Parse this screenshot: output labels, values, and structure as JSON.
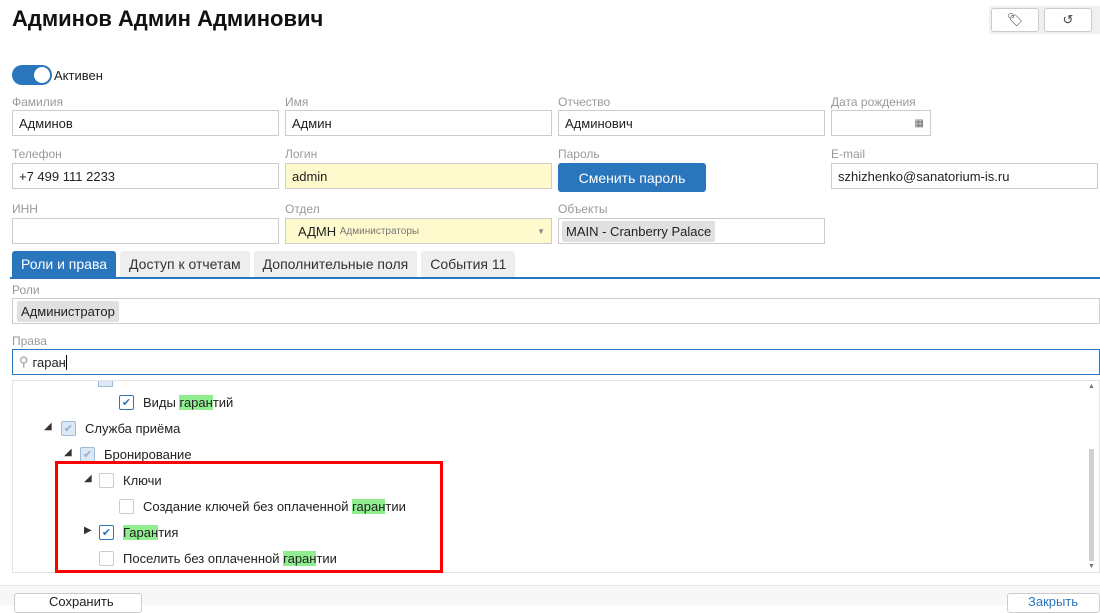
{
  "header": {
    "title": "Админов Админ Админович",
    "tag_icon": "tag-icon",
    "history_icon": "history-icon"
  },
  "status": {
    "label": "Активен",
    "active": true
  },
  "fields": {
    "lastname": {
      "label": "Фамилия",
      "value": "Админов"
    },
    "firstname": {
      "label": "Имя",
      "value": "Админ"
    },
    "middlename": {
      "label": "Отчество",
      "value": "Админович"
    },
    "birthdate": {
      "label": "Дата рождения",
      "value": ""
    },
    "phone": {
      "label": "Телефон",
      "value": "+7 499 111 2233"
    },
    "login": {
      "label": "Логин",
      "value": "admin"
    },
    "password": {
      "label": "Пароль",
      "button": "Сменить пароль"
    },
    "email": {
      "label": "E-mail",
      "value": "szhizhenko@sanatorium-is.ru"
    },
    "inn": {
      "label": "ИНН",
      "value": ""
    },
    "department": {
      "label": "Отдел",
      "code": "АДМН",
      "name": "Администраторы"
    },
    "objects": {
      "label": "Объекты",
      "value": "MAIN - Cranberry Palace"
    }
  },
  "tabs": [
    {
      "label": "Роли и права"
    },
    {
      "label": "Доступ к отчетам"
    },
    {
      "label": "Дополнительные поля"
    },
    {
      "label": "События 11"
    }
  ],
  "roles": {
    "label": "Роли",
    "value": "Администратор"
  },
  "rights": {
    "label": "Права",
    "search": "гаран"
  },
  "tree": [
    {
      "pre": "Виды ",
      "hl": "гаран",
      "post": "тий",
      "state": "checked"
    },
    {
      "pre": "Служба приёма",
      "hl": "",
      "post": "",
      "state": "partial",
      "expanded": true
    },
    {
      "pre": "Бронирование",
      "hl": "",
      "post": "",
      "state": "partial",
      "expanded": true
    },
    {
      "pre": "Ключи",
      "hl": "",
      "post": "",
      "state": "unchecked",
      "expanded": true
    },
    {
      "pre": "Создание ключей без оплаченной ",
      "hl": "гаран",
      "post": "тии",
      "state": "unchecked"
    },
    {
      "pre": "",
      "hl": "Гаран",
      "post": "тия",
      "state": "checked",
      "expanded": false
    },
    {
      "pre": "Поселить без оплаченной ",
      "hl": "гаран",
      "post": "тии",
      "state": "unchecked"
    }
  ],
  "footer": {
    "save": "Сохранить",
    "close": "Закрыть"
  },
  "colors": {
    "accent": "#2a76bd",
    "highlight": "#90ee90",
    "annotation": "#ff0000"
  }
}
